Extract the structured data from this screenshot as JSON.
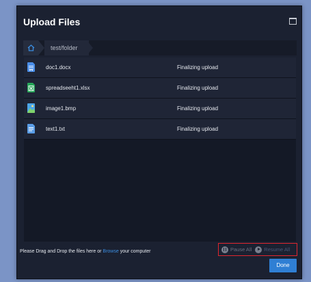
{
  "dialog": {
    "title": "Upload Files"
  },
  "breadcrumb": {
    "folder": "test/folder"
  },
  "files": [
    {
      "name": "doc1.docx",
      "status": "Finalizing upload",
      "icon": "word-doc-icon",
      "color": "#4a8ee8"
    },
    {
      "name": "spreadseeht1.xlsx",
      "status": "Finalizing upload",
      "icon": "excel-sheet-icon",
      "color": "#27a659"
    },
    {
      "name": "image1.bmp",
      "status": "Finalizing upload",
      "icon": "image-file-icon",
      "color": "#4ca6e8"
    },
    {
      "name": "text1.txt",
      "status": "Finalizing upload",
      "icon": "text-file-icon",
      "color": "#5a9de6"
    }
  ],
  "footer": {
    "hint_before": "Please Drag and Drop the files here or ",
    "browse_label": "Browse",
    "hint_after": " your computer",
    "pause_all": "Pause All",
    "resume_all": "Resume All",
    "done": "Done"
  },
  "colors": {
    "accent": "#2f7fd4",
    "dialog_bg": "#1b2131",
    "highlight_border": "#e0262e"
  }
}
